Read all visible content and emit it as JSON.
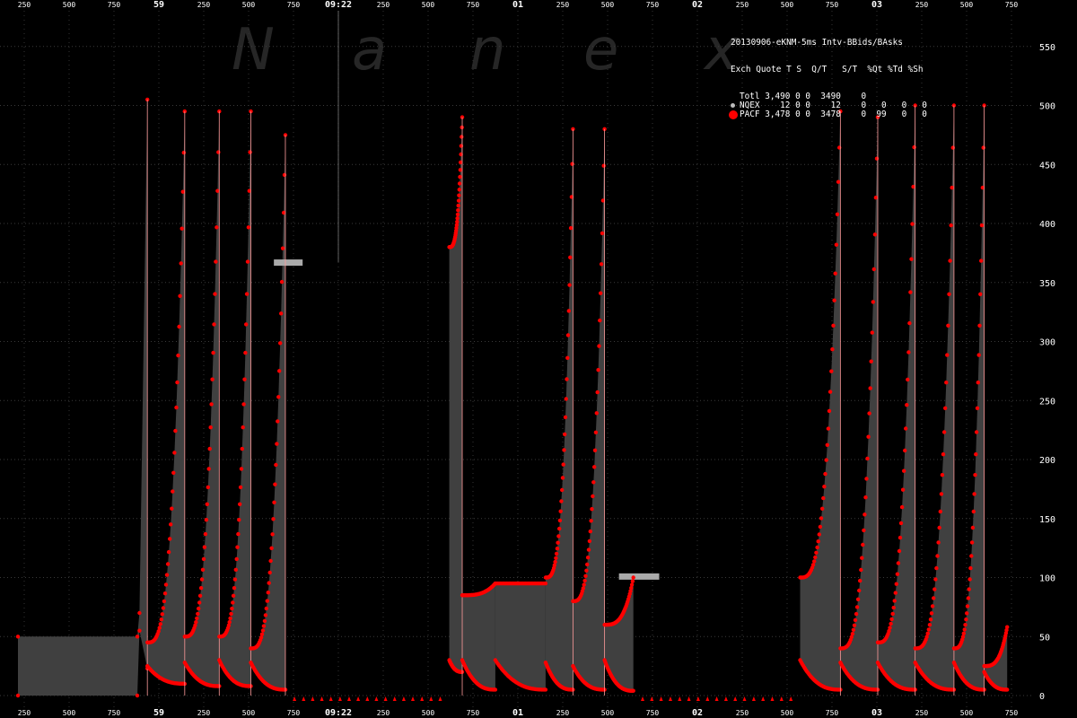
{
  "chart_data": {
    "type": "area",
    "title": "20130906-eKNM-5ms Intv-BBids/BAsks",
    "watermark": "N  a  n  e  x",
    "ylim": [
      0,
      580
    ],
    "yticks": [
      0,
      50,
      100,
      150,
      200,
      250,
      300,
      350,
      400,
      450,
      500,
      550
    ],
    "grid": true,
    "xtick_labels": [
      "250",
      "500",
      "750",
      "59",
      "250",
      "500",
      "750",
      "09:22",
      "250",
      "500",
      "750",
      "01",
      "250",
      "500",
      "750",
      "02",
      "250",
      "500",
      "750",
      "03",
      "250",
      "500",
      "750"
    ],
    "major_labels": [
      "59",
      "09:22",
      "01",
      "02",
      "03"
    ],
    "legend": {
      "position": "top-right",
      "header": "Exch Quote T S  Q/T   S/T  %Qt %Td %Sh",
      "rows": [
        {
          "text": "Totl 3,490 0 0  3490    0",
          "color": "#000000"
        },
        {
          "text": "NQEX    12 0 0    12    0   0   0   0",
          "color": "#bbbbbb"
        },
        {
          "text": "PACF 3,478 0 0  3478    0  99   0   0",
          "color": "#ff0000"
        }
      ]
    },
    "series": [
      {
        "name": "PACF",
        "color": "#ff0000",
        "fill_color": "#404040",
        "segments": [
          {
            "x": [
              0.0,
              8.3,
              8.45,
              9.0
            ],
            "bid": [
              50,
              50,
              55,
              23
            ],
            "ask": [
              0,
              0,
              70,
              505
            ]
          },
          {
            "x": [
              9.0,
              11.6
            ],
            "bid": [
              25,
              10
            ],
            "ask": [
              45,
              495
            ]
          },
          {
            "x": [
              11.6,
              14.0
            ],
            "bid": [
              28,
              8
            ],
            "ask": [
              50,
              495
            ]
          },
          {
            "x": [
              14.0,
              16.2
            ],
            "bid": [
              30,
              8
            ],
            "ask": [
              50,
              495
            ]
          },
          {
            "x": [
              16.2,
              18.6
            ],
            "bid": [
              28,
              5
            ],
            "ask": [
              40,
              475
            ]
          },
          {
            "x": [
              18.6,
              30.0
            ],
            "bid": [
              365,
              365
            ],
            "ask": [
              365,
              365
            ]
          },
          {
            "x": [
              30.0,
              30.9
            ],
            "bid": [
              30,
              20
            ],
            "ask": [
              380,
              490
            ]
          },
          {
            "x": [
              30.9,
              33.2
            ],
            "bid": [
              30,
              5
            ],
            "ask": [
              85,
              95
            ]
          },
          {
            "x": [
              33.2,
              36.7
            ],
            "bid": [
              30,
              5
            ],
            "ask": [
              95,
              95
            ]
          },
          {
            "x": [
              36.7,
              38.6
            ],
            "bid": [
              28,
              5
            ],
            "ask": [
              100,
              480
            ]
          },
          {
            "x": [
              38.6,
              40.8
            ],
            "bid": [
              25,
              5
            ],
            "ask": [
              80,
              480
            ]
          },
          {
            "x": [
              40.8,
              42.8
            ],
            "bid": [
              30,
              4
            ],
            "ask": [
              60,
              100
            ]
          },
          {
            "x": [
              42.8,
              54.4
            ],
            "bid": [
              98,
              98
            ],
            "ask": [
              98,
              98
            ]
          },
          {
            "x": [
              54.4,
              57.2
            ],
            "bid": [
              30,
              5
            ],
            "ask": [
              100,
              495
            ]
          },
          {
            "x": [
              57.2,
              59.8
            ],
            "bid": [
              28,
              5
            ],
            "ask": [
              40,
              490
            ]
          },
          {
            "x": [
              59.8,
              62.4
            ],
            "bid": [
              28,
              5
            ],
            "ask": [
              45,
              500
            ]
          },
          {
            "x": [
              62.4,
              65.1
            ],
            "bid": [
              28,
              5
            ],
            "ask": [
              40,
              500
            ]
          },
          {
            "x": [
              65.1,
              67.2
            ],
            "bid": [
              28,
              5
            ],
            "ask": [
              40,
              500
            ]
          },
          {
            "x": [
              67.2,
              68.8
            ],
            "bid": [
              20,
              5
            ],
            "ask": [
              25,
              58
            ]
          }
        ]
      },
      {
        "name": "NQEX",
        "color": "#bbbbbb",
        "ask_steps": [
          {
            "x": [
              17.8,
              19.8
            ],
            "y": 368
          },
          {
            "x": [
              41.8,
              44.6
            ],
            "y": 102
          }
        ]
      }
    ]
  }
}
